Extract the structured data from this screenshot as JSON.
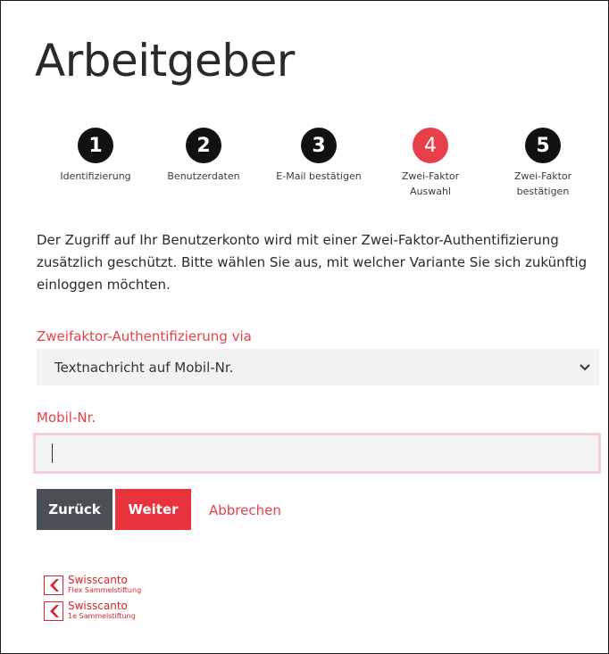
{
  "page": {
    "title": "Arbeitgeber"
  },
  "steps": [
    {
      "number": "1",
      "label": "Identifizierung",
      "active": false
    },
    {
      "number": "2",
      "label": "Benutzerdaten",
      "active": false
    },
    {
      "number": "3",
      "label": "E-Mail bestätigen",
      "active": false
    },
    {
      "number": "4",
      "label": "Zwei-Faktor\nAuswahl",
      "active": true
    },
    {
      "number": "5",
      "label": "Zwei-Faktor\nbestätigen",
      "active": false
    }
  ],
  "intro": "Der Zugriff auf Ihr Benutzerkonto wird mit einer Zwei-Faktor-Authentifizierung zusätzlich geschützt. Bitte wählen Sie aus, mit welcher Variante Sie sich zukünftig einloggen möchten.",
  "twofactor": {
    "label": "Zweifaktor-Authentifizierung via",
    "selected": "Textnachricht auf Mobil-Nr."
  },
  "mobile": {
    "label": "Mobil-Nr.",
    "value": ""
  },
  "actions": {
    "back": "Zurück",
    "next": "Weiter",
    "cancel": "Abbrechen"
  },
  "logos": [
    {
      "name": "Swisscanto",
      "sub": "Flex Sammelstiftung"
    },
    {
      "name": "Swisscanto",
      "sub": "1e Sammelstiftung"
    }
  ],
  "colors": {
    "accent": "#e8404a",
    "step_inactive": "#111111",
    "back_button": "#4a4e55"
  }
}
